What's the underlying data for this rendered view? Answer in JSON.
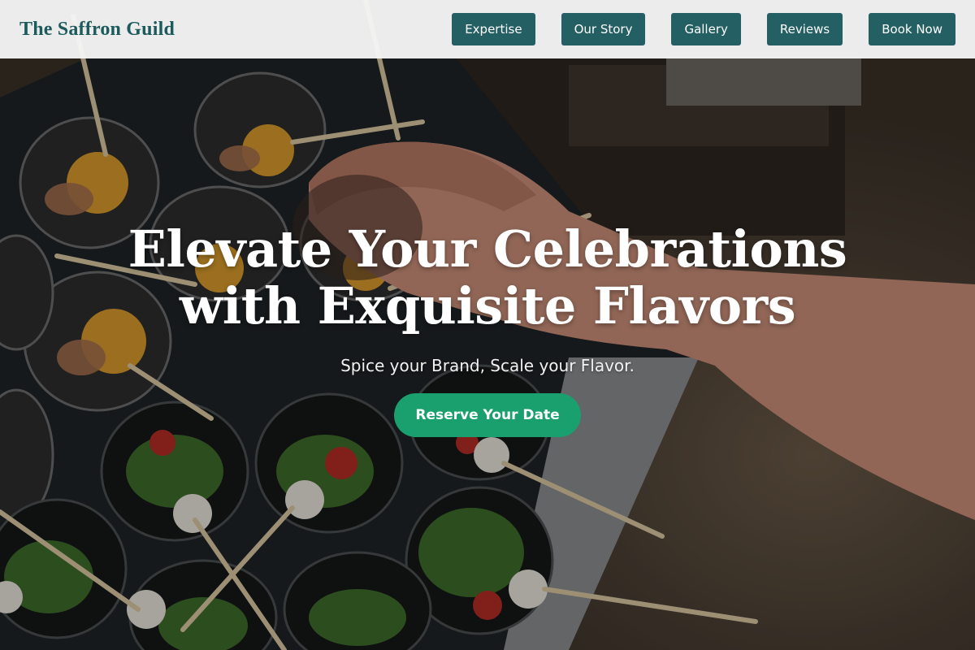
{
  "brand": {
    "name": "The Saffron Guild"
  },
  "nav": {
    "items": [
      {
        "label": "Expertise"
      },
      {
        "label": "Our Story"
      },
      {
        "label": "Gallery"
      },
      {
        "label": "Reviews"
      },
      {
        "label": "Book Now"
      }
    ]
  },
  "hero": {
    "title_line1": "Elevate Your Celebrations",
    "title_line2": "with Exquisite Flavors",
    "subtitle": "Spice your Brand, Scale your Flavor.",
    "cta_label": "Reserve Your Date",
    "background_image": "catering-appetizers-photo"
  },
  "colors": {
    "brand_text": "#1d5a5c",
    "nav_button": "#235f63",
    "cta": "#1aa06f",
    "nav_bg": "#f5f5f5"
  }
}
